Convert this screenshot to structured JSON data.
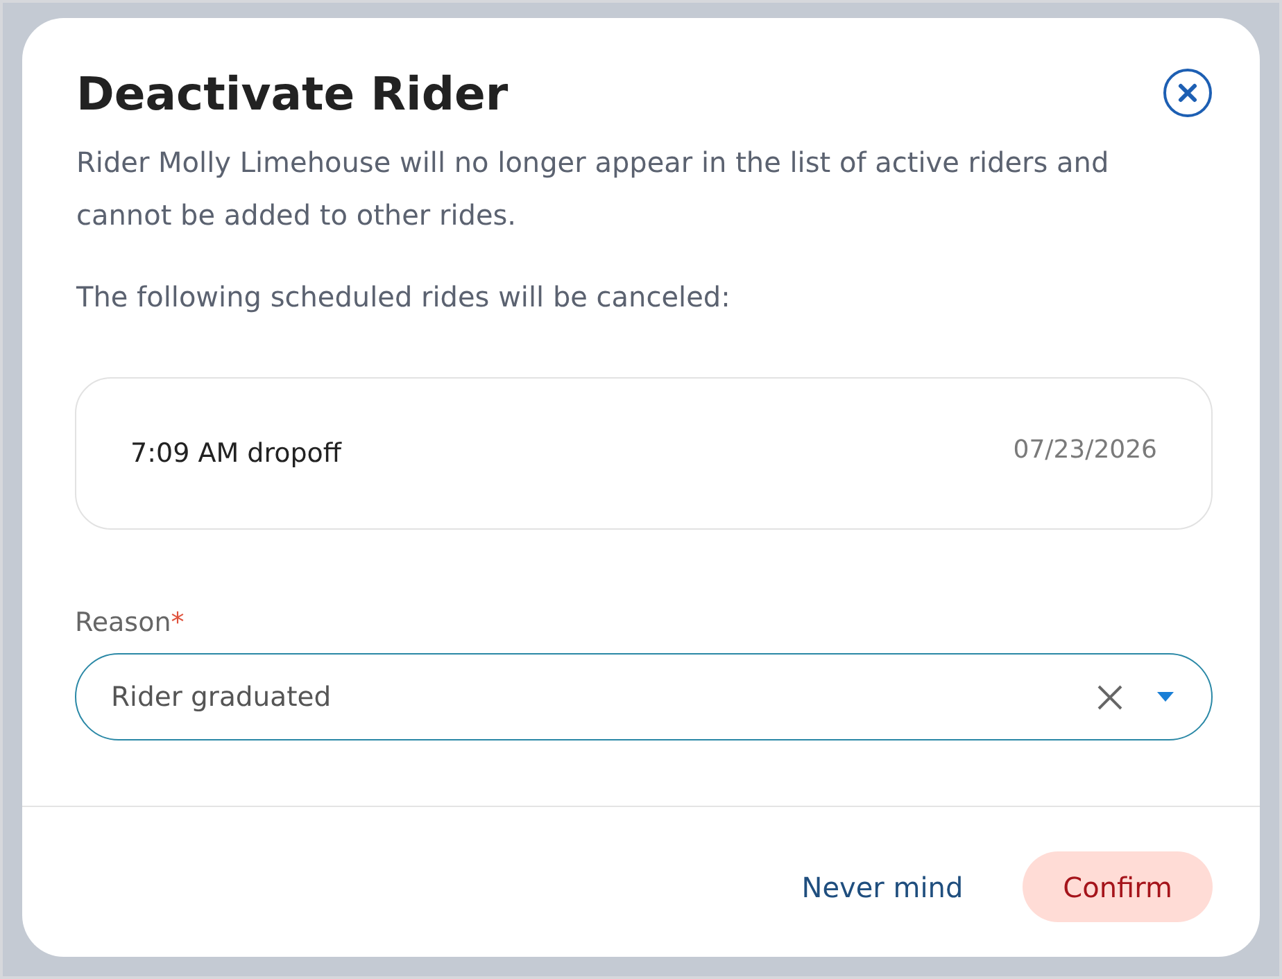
{
  "dialog": {
    "title": "Deactivate Rider",
    "description": "Rider Molly Limehouse will no longer appear in the list of active riders and cannot be added to other rides.",
    "list_heading": "The following scheduled rides will be canceled:",
    "rides": [
      {
        "name": "7:09 AM dropoff",
        "date": "07/23/2026"
      }
    ],
    "reason": {
      "label": "Reason",
      "required_mark": "*",
      "value": "Rider graduated",
      "focused": true
    },
    "buttons": [
      {
        "label": "Never mind",
        "kind": "text"
      },
      {
        "label": "Confirm",
        "kind": "primary"
      }
    ]
  }
}
